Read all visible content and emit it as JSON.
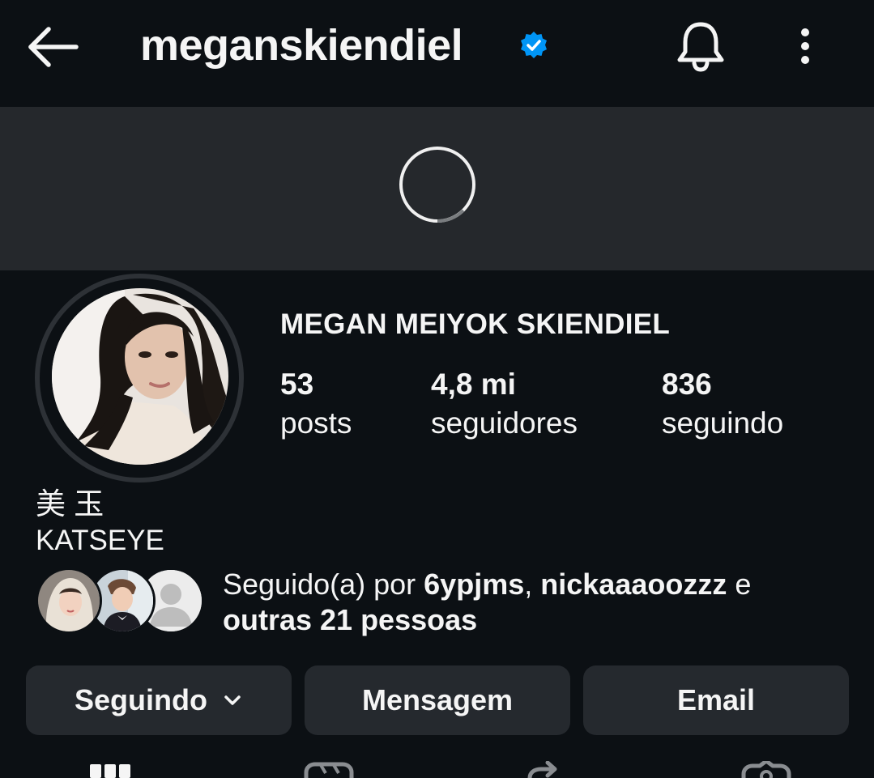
{
  "header": {
    "username": "meganskiendiel",
    "icons": {
      "back": "arrow-left-icon",
      "verified": "verified-badge-icon",
      "notifications": "bell-icon",
      "more": "more-vertical-icon"
    }
  },
  "cover": {
    "icon": "loading-spinner-icon"
  },
  "profile": {
    "full_name": "MEGAN MEIYOK SKIENDIEL",
    "stats": [
      {
        "value": "53",
        "label": "posts"
      },
      {
        "value": "4,8 mi",
        "label": "seguidores"
      },
      {
        "value": "836",
        "label": "seguindo"
      }
    ],
    "bio_line1": "美 玉",
    "bio_line2": "KATSEYE"
  },
  "followed_by": {
    "prefix": "Seguido(a) por ",
    "user1": "6ypjms",
    "separator": ", ",
    "user2": "nickaaaoozzz",
    "joiner": " e ",
    "others": "outras 21 pessoas"
  },
  "buttons": {
    "following": "Seguindo",
    "message": "Mensagem",
    "email": "Email"
  },
  "tabs": [
    "grid-icon",
    "reels-icon",
    "reposts-icon",
    "tagged-icon"
  ],
  "colors": {
    "background": "#0c1014",
    "cover": "#25282c",
    "button": "#25292e",
    "verified": "#0095f6"
  }
}
